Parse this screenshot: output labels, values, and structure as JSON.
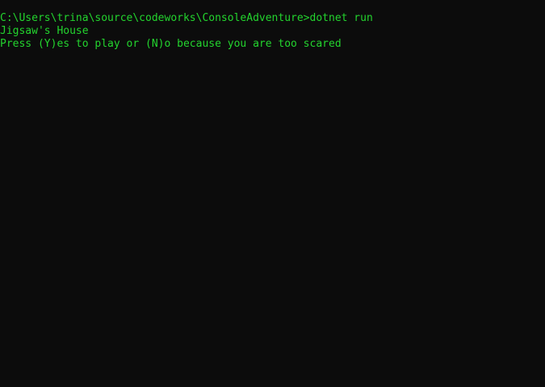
{
  "console": {
    "prompt_path": "C:\\Users\\trina\\source\\codeworks\\ConsoleAdventure>",
    "command": "dotnet run",
    "output_lines": [
      "Jigsaw's House",
      "Press (Y)es to play or (N)o because you are too scared"
    ],
    "colors": {
      "background": "#0c0c0c",
      "text": "#23d42e"
    }
  }
}
